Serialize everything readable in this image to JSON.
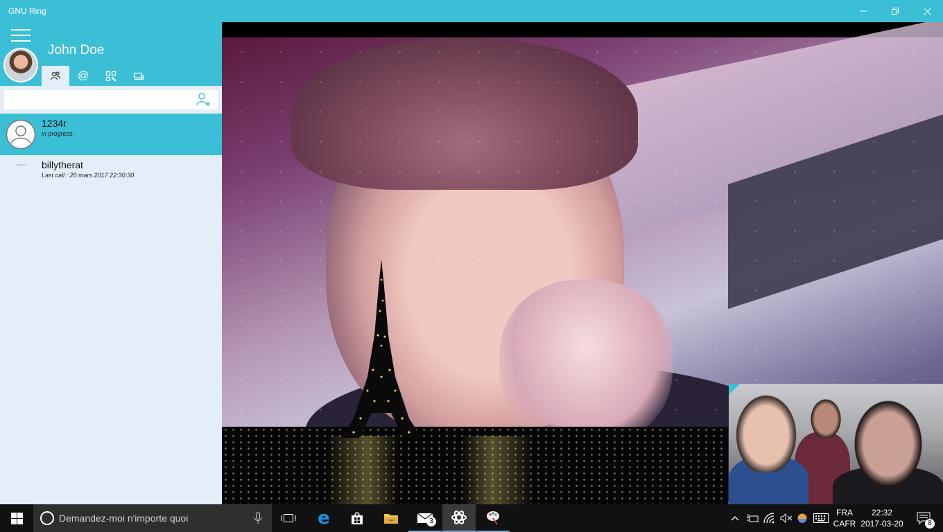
{
  "window": {
    "title": "GNU Ring",
    "minimize_icon": "minimize-icon",
    "restore_icon": "restore-icon",
    "close_icon": "close-icon"
  },
  "sidebar": {
    "username": "John Doe",
    "tabs": [
      {
        "icon": "contacts-icon"
      },
      {
        "icon": "at-icon",
        "label": "@"
      },
      {
        "icon": "qr-code-icon"
      },
      {
        "icon": "devices-icon"
      }
    ],
    "search": {
      "value": "",
      "placeholder": ""
    },
    "contacts": [
      {
        "name": "1234r",
        "status": "in progress."
      },
      {
        "name": "billytherat",
        "status": "Last call : 20 mars 2017 22:30:30."
      }
    ]
  },
  "colors": {
    "accent": "#3bbfd6",
    "sidebar_bg": "#e3eef8",
    "taskbar_bg": "#111111"
  },
  "taskbar": {
    "search_placeholder": "Demandez-moi n'importe quoi",
    "mail_badge": "3",
    "lang_top": "FRA",
    "lang_bottom": "CAFR",
    "time": "22:32",
    "date": "2017-03-20",
    "notifications_badge": "8"
  }
}
